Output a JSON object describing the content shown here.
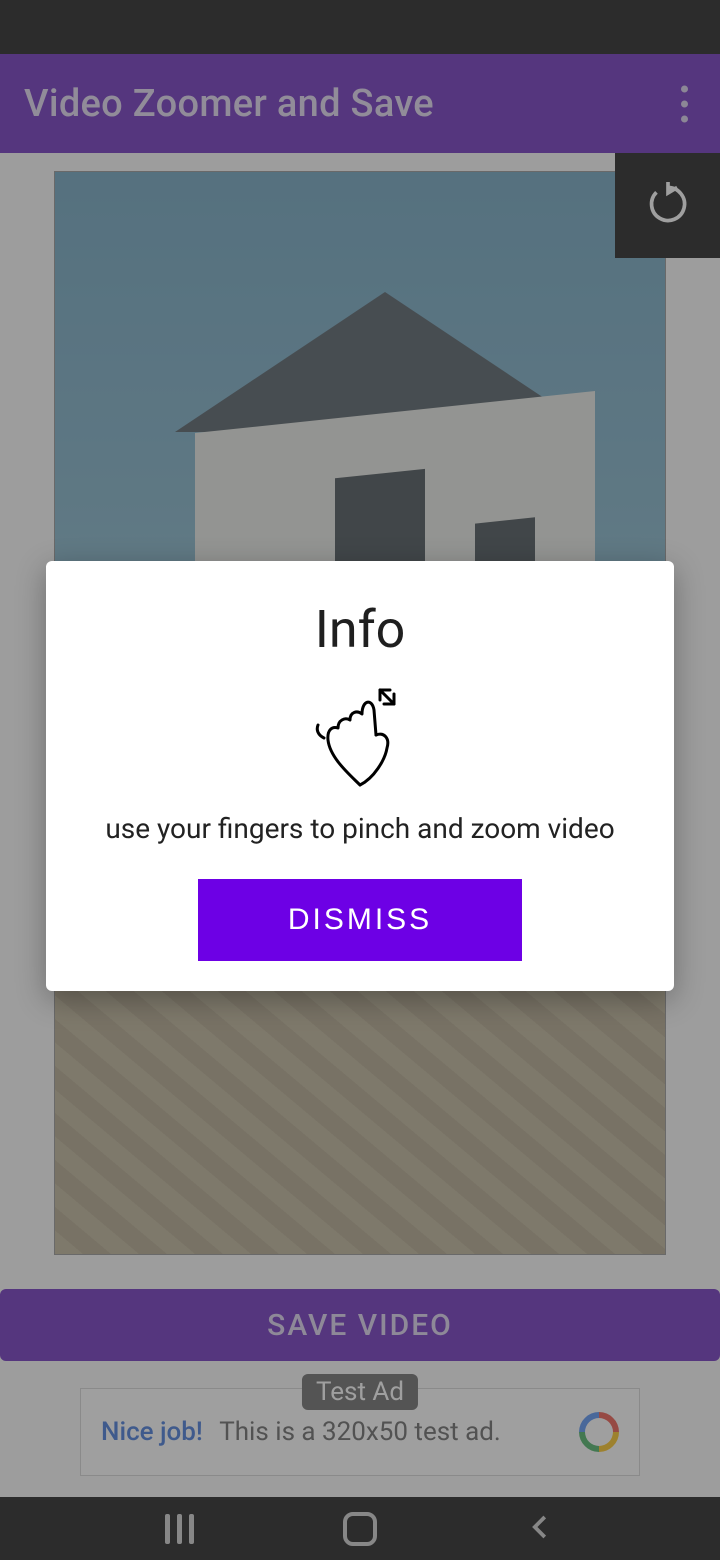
{
  "appbar": {
    "title": "Video Zoomer and Save"
  },
  "rotate_icon": "rotate-icon",
  "save_button": {
    "label": "SAVE VIDEO"
  },
  "ad": {
    "badge": "Test Ad",
    "left_text": "Nice job!",
    "body_text": "This is a 320x50 test ad."
  },
  "dialog": {
    "title": "Info",
    "message": "use your fingers to pinch and zoom video",
    "dismiss_label": "DISMISS"
  }
}
